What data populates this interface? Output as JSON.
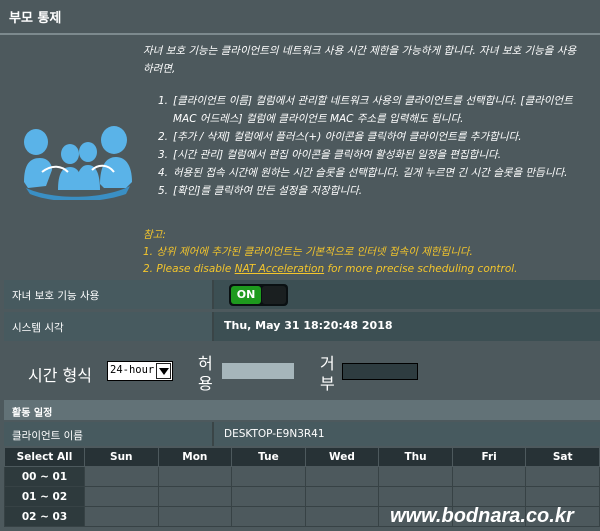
{
  "page": {
    "title": "부모 통제"
  },
  "intro": "자녀 보호 기능는 클라이언트의 네트워크 사용 시간 제한을 가능하게 합니다. 자녀 보호 기능을 사용하려면,",
  "steps": [
    {
      "num": "1.",
      "text": "[클라이언트 이름] 컬럼에서 관리할 네트워크 사용의 클라이언트를 선택합니다. [클라이언트 MAC 어드레스] 컬럼에 클라이언트 MAC 주소를 입력해도 됩니다."
    },
    {
      "num": "2.",
      "text": "[추가 / 삭제] 컬럼에서 플러스(+) 아이콘을 클릭하여 클라이언트를 추가합니다."
    },
    {
      "num": "3.",
      "text": "[시간 관리] 컬럼에서 편집 아이콘을 클릭하여 활성화된 일정을 편집합니다."
    },
    {
      "num": "4.",
      "text": "허용된 접속 시간에 원하는 시간 슬롯을 선택합니다. 길게 누르면 긴 시간 슬롯을 만듭니다."
    },
    {
      "num": "5.",
      "text": "[확인]를 클릭하여 만든 설정을 저장합니다."
    }
  ],
  "note": {
    "title": "참고:",
    "line1": "1. 상위 제어에 추가된 클라이언트는 기본적으로 인터넷 접속이 제한됩니다.",
    "line2_prefix": "2. Please disable ",
    "line2_link": "NAT Acceleration",
    "line2_suffix": " for more precise scheduling control."
  },
  "settings": {
    "enable_label": "자녀 보호 기능 사용",
    "toggle_on": "ON",
    "systime_label": "시스템 시각",
    "systime_value": "Thu, May 31 18:20:48 2018"
  },
  "format": {
    "label": "시간 형식",
    "selected": "24-hour",
    "allow_label": "허용",
    "deny_label": "거부"
  },
  "schedule": {
    "title": "활동 일정",
    "client_label": "클라이언트 이름",
    "client_value": "DESKTOP-E9N3R41",
    "select_all": "Select All",
    "days": [
      "Sun",
      "Mon",
      "Tue",
      "Wed",
      "Thu",
      "Fri",
      "Sat"
    ],
    "times": [
      "00 ~ 01",
      "01 ~ 02",
      "02 ~ 03"
    ]
  },
  "watermark": "www.bodnara.co.kr",
  "colors": {
    "background": "#4d595d",
    "toggle_on": "#1e9a1e",
    "note": "#f3c52c",
    "icon": "#5ab3e8"
  }
}
